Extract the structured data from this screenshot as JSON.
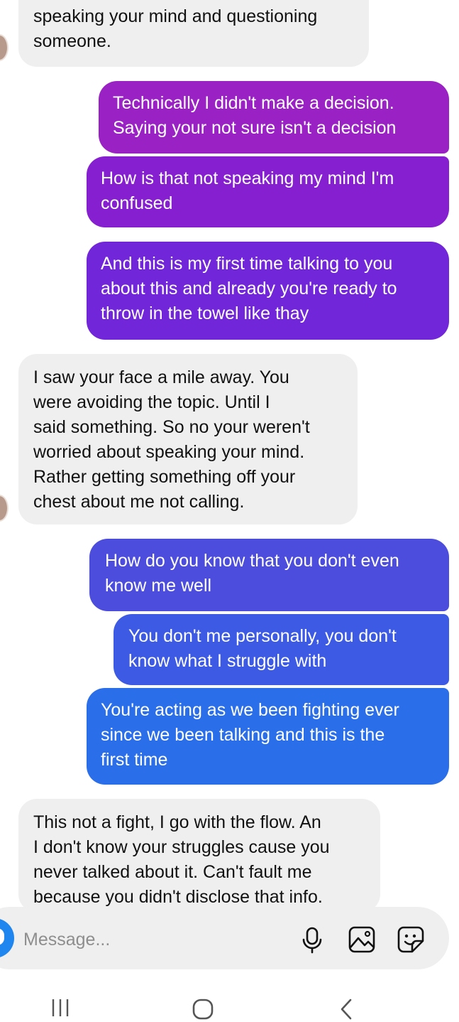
{
  "messages": [
    {
      "sender": "them",
      "lines": [
        "speaking your mind and questioning",
        "someone."
      ]
    },
    {
      "sender": "me",
      "lines": [
        "Technically I didn't make a decision.",
        "Saying your not sure isn't a decision"
      ]
    },
    {
      "sender": "me",
      "lines": [
        "How is that not speaking my mind I'm",
        "confused"
      ]
    },
    {
      "sender": "me",
      "lines": [
        "And this is my first time talking to you",
        "about this and already you're ready to",
        "throw in the towel like thay"
      ]
    },
    {
      "sender": "them",
      "lines": [
        "I saw your face a mile away. You",
        "were avoiding the topic. Until I",
        "said something. So no your weren't",
        "worried about speaking your mind.",
        "Rather getting something off your",
        "chest about me not calling."
      ]
    },
    {
      "sender": "me",
      "lines": [
        "How do you know that you don't even",
        "know me well"
      ]
    },
    {
      "sender": "me",
      "lines": [
        "You don't me personally,  you don't",
        "know what I struggle with"
      ]
    },
    {
      "sender": "me",
      "lines": [
        "You're acting as we been fighting ever",
        "since we been talking and this is the",
        "first time"
      ]
    },
    {
      "sender": "them",
      "lines": [
        "This not a fight, I go with the flow. An",
        "I don't know your struggles cause you",
        "never talked about it. Can't fault me",
        "because you didn't disclose that info."
      ]
    }
  ],
  "composer": {
    "placeholder": "Message...",
    "icons": [
      "camera-icon",
      "microphone-icon",
      "gallery-icon",
      "sticker-icon"
    ]
  },
  "navbar": {
    "icons": [
      "recent-apps-icon",
      "home-icon",
      "back-icon"
    ]
  }
}
